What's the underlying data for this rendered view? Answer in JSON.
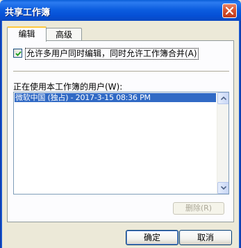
{
  "window": {
    "title": "共享工作簿"
  },
  "tabs": [
    {
      "label": "编辑",
      "active": true
    },
    {
      "label": "高级",
      "active": false
    }
  ],
  "edit": {
    "allow_multi_user": {
      "label": "允许多用户同时编辑，同时允许工作簿合并(A)",
      "checked": true
    },
    "users_label": "正在使用本工作簿的用户(W):",
    "users": [
      "微软中国 (独占) - 2017-3-15 08:36 PM"
    ],
    "remove_button": "删除(R)"
  },
  "buttons": {
    "ok": "确定",
    "cancel": "取消"
  },
  "icons": {
    "close": "close-icon",
    "check": "check-icon",
    "scroll_up": "chevron-up-icon",
    "scroll_down": "chevron-down-icon"
  }
}
